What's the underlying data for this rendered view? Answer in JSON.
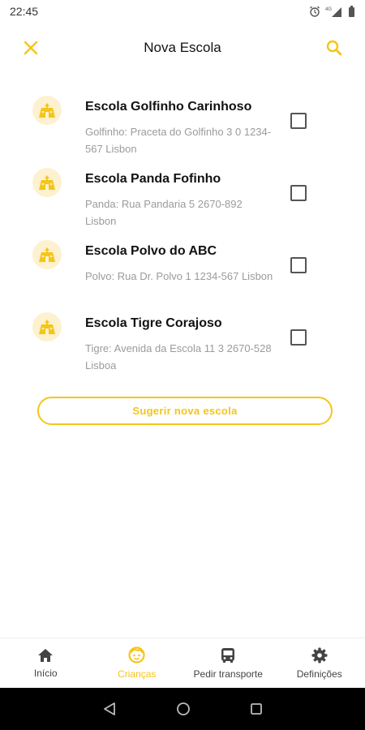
{
  "status_bar": {
    "time": "22:45",
    "network": "4G"
  },
  "header": {
    "title": "Nova Escola",
    "close_icon": "close-icon",
    "search_icon": "search-icon"
  },
  "schools": [
    {
      "name": "Escola Golfinho Carinhoso",
      "address": "Golfinho: Praceta do Golfinho 3 0 1234-567 Lisbon",
      "checked": false
    },
    {
      "name": "Escola Panda Fofinho",
      "address": "Panda: Rua Pandaria 5 2670-892 Lisbon",
      "checked": false
    },
    {
      "name": "Escola Polvo do ABC",
      "address": "Polvo: Rua Dr. Polvo 1 1234-567 Lisbon",
      "checked": false
    },
    {
      "name": "Escola Tigre Corajoso",
      "address": "Tigre: Avenida da Escola 11 3 2670-528 Lisboa",
      "checked": false
    }
  ],
  "suggest_button": {
    "label": "Sugerir nova escola"
  },
  "bottom_nav": {
    "items": [
      {
        "label": "Início",
        "icon": "home-icon",
        "active": false
      },
      {
        "label": "Crianças",
        "icon": "child-face-icon",
        "active": true
      },
      {
        "label": "Pedir transporte",
        "icon": "bus-icon",
        "active": false
      },
      {
        "label": "Definições",
        "icon": "gear-icon",
        "active": false
      }
    ]
  },
  "colors": {
    "accent": "#f5c518",
    "avatar_bg": "#fdf1cf",
    "muted_text": "#9b9b9b"
  }
}
